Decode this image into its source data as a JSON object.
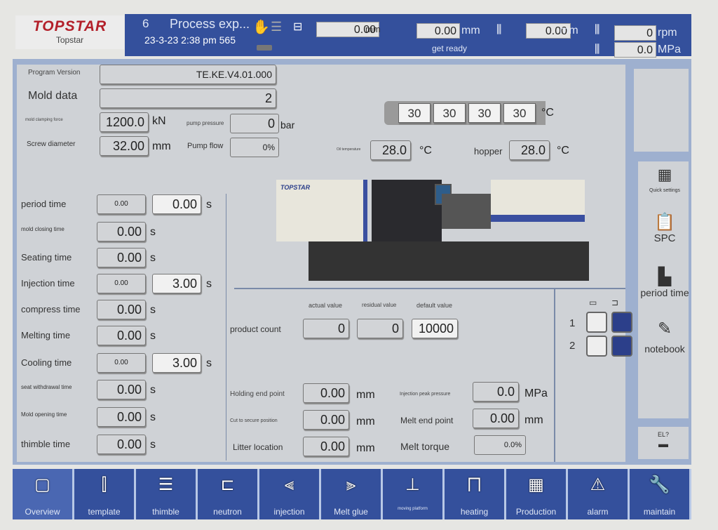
{
  "header": {
    "logo": "TOPSTAR",
    "logo_sub": "Topstar",
    "mold_no": "6",
    "title": "Process exp...",
    "datetime": "23-3-23 2:38 pm 565",
    "position": {
      "value": "0.00",
      "unit": "mm"
    },
    "injection_pos": {
      "value": "0.00",
      "unit": "mm"
    },
    "melt_pos": {
      "value": "0.00",
      "unit": "mm"
    },
    "speed": {
      "value": "0",
      "unit": "rpm"
    },
    "pressure": {
      "value": "0.0",
      "unit": "MPa"
    },
    "status": "get ready"
  },
  "info": {
    "program_version_label": "Program Version",
    "program_version": "TE.KE.V4.01.000",
    "mold_data_label": "Mold data",
    "mold_data": "2",
    "clamp_label": "mold clamping force",
    "clamp": "1200.0",
    "clamp_unit": "kN",
    "screw_label": "Screw diameter",
    "screw": "32.00",
    "screw_unit": "mm",
    "pump_pressure_label": "pump pressure",
    "pump_pressure": "0",
    "pump_pressure_unit": "bar",
    "pump_flow_label": "Pump flow",
    "pump_flow": "0%"
  },
  "temps": {
    "barrel": [
      "30",
      "30",
      "30",
      "30"
    ],
    "unit": "°C",
    "oil_label": "Oil temperature",
    "oil": "28.0",
    "hopper_label": "hopper",
    "hopper": "28.0"
  },
  "machine": {
    "brand": "TOPSTAR"
  },
  "times": [
    {
      "label": "period time",
      "actual": "0.00",
      "set": "0.00",
      "unit": "s"
    },
    {
      "label": "mold closing time",
      "actual": "0.00",
      "unit": "s"
    },
    {
      "label": "Seating time",
      "actual": "0.00",
      "unit": "s"
    },
    {
      "label": "Injection time",
      "actual": "0.00",
      "set": "3.00",
      "unit": "s"
    },
    {
      "label": "compress time",
      "actual": "0.00",
      "unit": "s"
    },
    {
      "label": "Melting time",
      "actual": "0.00",
      "unit": "s"
    },
    {
      "label": "Cooling time",
      "actual": "0.00",
      "set": "3.00",
      "unit": "s"
    },
    {
      "label": "seat withdrawal time",
      "actual": "0.00",
      "unit": "s"
    },
    {
      "label": "Mold opening time",
      "actual": "0.00",
      "unit": "s"
    },
    {
      "label": "thimble time",
      "actual": "0.00",
      "unit": "s"
    }
  ],
  "count": {
    "label": "product count",
    "actual_label": "actual value",
    "residual_label": "residual value",
    "default_label": "default value",
    "actual": "0",
    "residual": "0",
    "default": "10000"
  },
  "positions": {
    "holding_label": "Holding end point",
    "holding": "0.00",
    "cut_label": "Cut to secure position",
    "cut": "0.00",
    "litter_label": "Litter location",
    "litter": "0.00",
    "mm": "mm",
    "peak_label": "Injection peak pressure",
    "peak": "0.0",
    "peak_unit": "MPa",
    "melt_end_label": "Melt end point",
    "melt_end": "0.00",
    "torque_label": "Melt torque",
    "torque": "0.0%"
  },
  "toggles": {
    "row1": "1",
    "row2": "2",
    "on_color": "#2c3f8a"
  },
  "side": {
    "quick": "Quick settings",
    "spc": "SPC",
    "period": "period time",
    "notebook": "notebook",
    "el": "EL?"
  },
  "nav": [
    {
      "label": "Overview",
      "icon": "monitor"
    },
    {
      "label": "template",
      "icon": "mold"
    },
    {
      "label": "thimble",
      "icon": "ejector"
    },
    {
      "label": "neutron",
      "icon": "core"
    },
    {
      "label": "injection",
      "icon": "injection"
    },
    {
      "label": "Melt glue",
      "icon": "screw"
    },
    {
      "label": "moving platform",
      "icon": "carriage"
    },
    {
      "label": "heating",
      "icon": "heater"
    },
    {
      "label": "Production",
      "icon": "production"
    },
    {
      "label": "alarm",
      "icon": "warning"
    },
    {
      "label": "maintain",
      "icon": "wrench"
    }
  ]
}
